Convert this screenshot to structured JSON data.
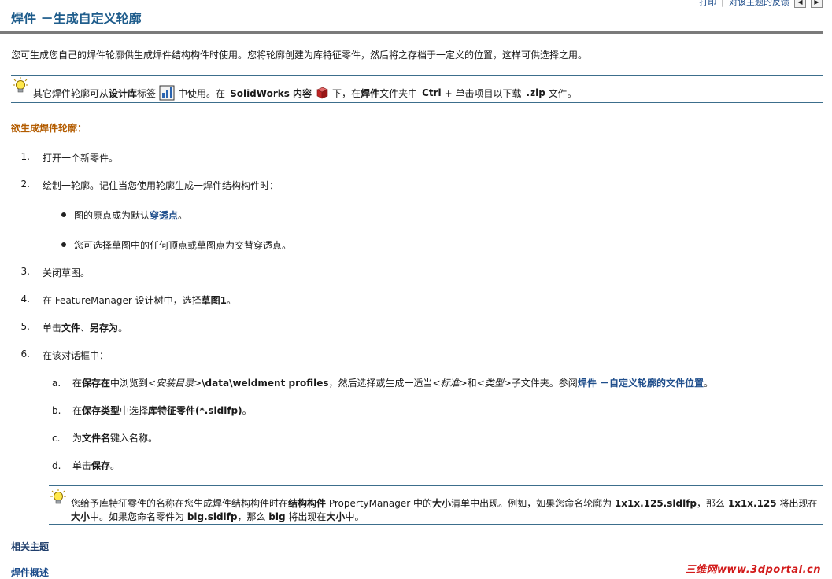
{
  "header": {
    "title": "焊件 －生成自定义轮廓",
    "links": [
      "打印",
      "对该主题的反馈"
    ],
    "sep": "|",
    "prev": "◀",
    "next": "▶"
  },
  "intro": "您可生成您自己的焊件轮廓供生成焊件结构构件时使用。您将轮廓创建为库特征零件，然后将之存档于一定义的位置，这样可供选择之用。",
  "tip1": {
    "a": "其它焊件轮廓可从",
    "b": "设计库",
    "c": "标签",
    "d": "中使用。在",
    "e": "SolidWorks 内容",
    "f": "下，在",
    "g": "焊件",
    "h": "文件夹中",
    "i": "Ctrl",
    "j": "+ 单击项目以下载",
    "k": ".zip",
    "l": "文件。"
  },
  "procedure_title": "欲生成焊件轮廓：",
  "steps": [
    {
      "num": "1.",
      "text": "打开一个新零件。"
    },
    {
      "num": "2.",
      "text": "绘制一轮廓。记住当您使用轮廓生成一焊件结构构件时："
    },
    {
      "num": "3.",
      "text": "关闭草图。"
    },
    {
      "num": "4.",
      "a": "在 FeatureManager 设计树中，选择",
      "b": "草图1",
      "c": "。"
    },
    {
      "num": "5.",
      "a": "单击",
      "b": "文件",
      "c": "、",
      "d": "另存为",
      "e": "。"
    },
    {
      "num": "6.",
      "text": "在该对话框中："
    }
  ],
  "bullets": [
    {
      "a": "图的原点成为默认",
      "link": "穿透点",
      "b": "。"
    },
    {
      "text": "您可选择草图中的任何顶点或草图点为交替穿透点。"
    }
  ],
  "substeps": [
    {
      "l": "a.",
      "a": "在",
      "b": "保存在",
      "c": "中浏览到<",
      "d": "安装目录",
      "e": ">",
      "f": "\\data\\weldment profiles",
      "g": "，然后选择或生成一适当<",
      "h": "标准",
      "i": ">和<",
      "j": "类型",
      "k": ">子文件夹。参阅",
      "link": "焊件 －自定义轮廓的文件位置",
      "m": "。"
    },
    {
      "l": "b.",
      "a": "在",
      "b": "保存类型",
      "c": "中选择",
      "d": "库特征零件(*.sldlfp)",
      "e": "。"
    },
    {
      "l": "c.",
      "a": "为",
      "b": "文件名",
      "c": "键入名称。"
    },
    {
      "l": "d.",
      "a": "单击",
      "b": "保存",
      "c": "。"
    }
  ],
  "tip2": {
    "a": "您给予库特征零件的名称在您生成焊件结构构件时在",
    "b": "结构构件",
    "c": " PropertyManager 中的",
    "d": "大小",
    "e": "清单中出现。例如，如果您命名轮廓为 ",
    "f": "1x1x.125.sldlfp",
    "g": "，那么 ",
    "h": "1x1x.125",
    "i": " 将出现在",
    "j": "大小",
    "k": "中。如果您命名零件为 ",
    "l": "big.sldlfp",
    "m": "，那么 ",
    "n": "big",
    "o": " 将出现在",
    "p": "大小",
    "q": "中。"
  },
  "related": {
    "title": "相关主题",
    "link": "焊件概述"
  },
  "watermark": "三维网www.3dportal.cn"
}
